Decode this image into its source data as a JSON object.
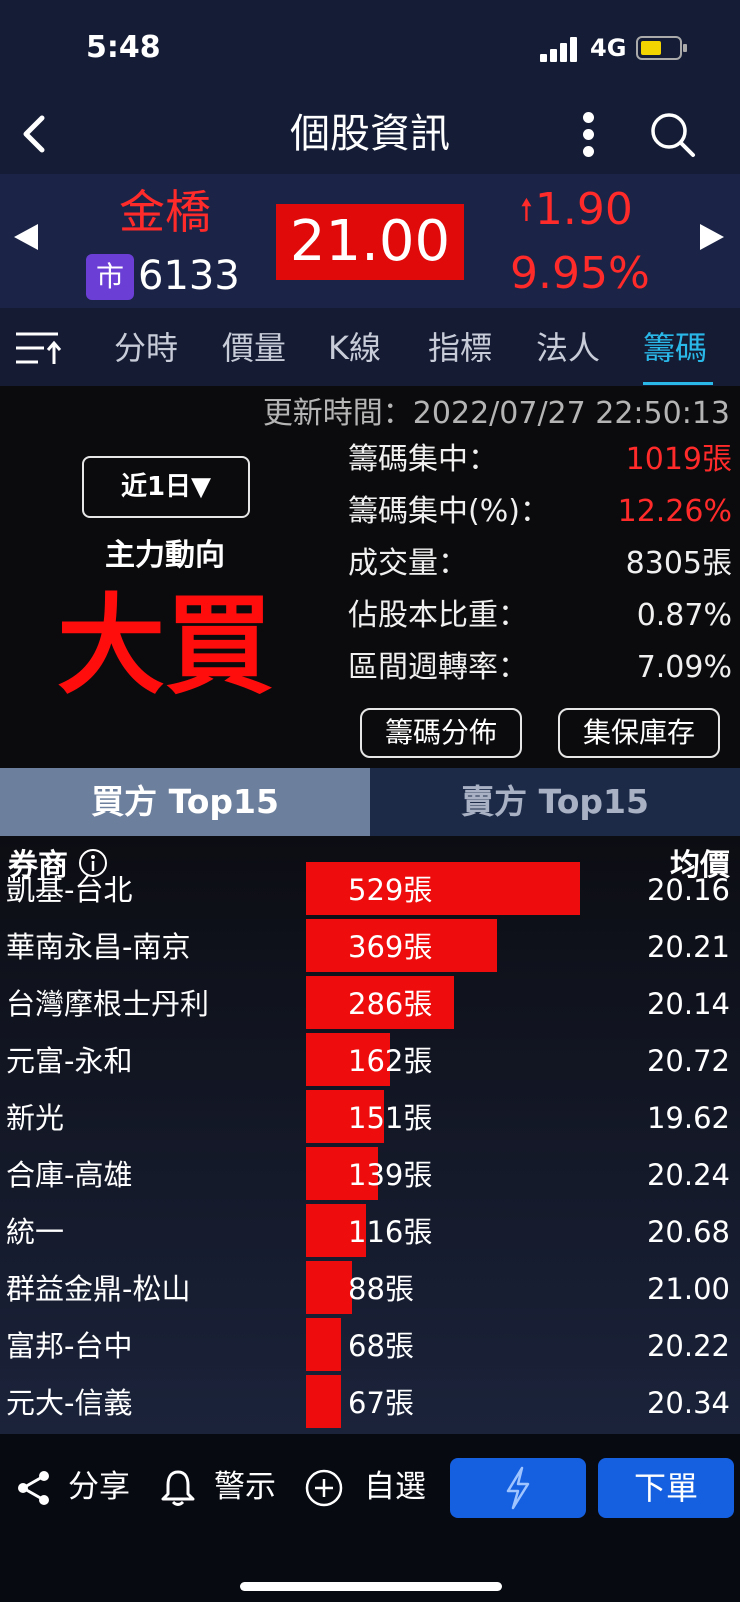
{
  "status": {
    "time": "5:48",
    "network": "4G"
  },
  "header": {
    "title": "個股資訊"
  },
  "quote": {
    "name": "金橋",
    "market_badge": "市",
    "code": "6133",
    "price": "21.00",
    "change": "1.90",
    "change_pct": "9.95%",
    "accent_color": "#ff2a2a"
  },
  "tabs": [
    {
      "label": "分時"
    },
    {
      "label": "價量"
    },
    {
      "label": "K線"
    },
    {
      "label": "指標"
    },
    {
      "label": "法人"
    },
    {
      "label": "籌碼"
    }
  ],
  "active_tab": "籌碼",
  "chips": {
    "update_time": "更新時間：2022/07/27 22:50:13",
    "period": "近1日▼",
    "main_trend_label": "主力動向",
    "main_trend_value": "大買",
    "stats": [
      {
        "label": "籌碼集中：",
        "value": "1019張"
      },
      {
        "label": "籌碼集中(%)：",
        "value": "12.26%"
      },
      {
        "label": "成交量：",
        "value": "8305張"
      },
      {
        "label": "佔股本比重：",
        "value": "0.87%"
      },
      {
        "label": "區間週轉率：",
        "value": "7.09%"
      }
    ],
    "buttons": {
      "distribution": "籌碼分佈",
      "custody": "集保庫存"
    }
  },
  "bs_tabs": {
    "buy": "買方 Top15",
    "sell": "賣方 Top15"
  },
  "table": {
    "col_broker": "券商",
    "col_avg": "均價",
    "rows": [
      {
        "broker": "凱基-台北",
        "qty_label": "529張",
        "qty": 529,
        "avg": "20.16"
      },
      {
        "broker": "華南永昌-南京",
        "qty_label": "369張",
        "qty": 369,
        "avg": "20.21"
      },
      {
        "broker": "台灣摩根士丹利",
        "qty_label": "286張",
        "qty": 286,
        "avg": "20.14"
      },
      {
        "broker": "元富-永和",
        "qty_label": "162張",
        "qty": 162,
        "avg": "20.72"
      },
      {
        "broker": "新光",
        "qty_label": "151張",
        "qty": 151,
        "avg": "19.62"
      },
      {
        "broker": "合庫-高雄",
        "qty_label": "139張",
        "qty": 139,
        "avg": "20.24"
      },
      {
        "broker": "統一",
        "qty_label": "116張",
        "qty": 116,
        "avg": "20.68"
      },
      {
        "broker": "群益金鼎-松山",
        "qty_label": "88張",
        "qty": 88,
        "avg": "21.00"
      },
      {
        "broker": "富邦-台中",
        "qty_label": "68張",
        "qty": 68,
        "avg": "20.22"
      },
      {
        "broker": "元大-信義",
        "qty_label": "67張",
        "qty": 67,
        "avg": "20.34"
      }
    ]
  },
  "toolbar": {
    "share": "分享",
    "alert": "警示",
    "watchlist": "自選",
    "order": "下單"
  }
}
